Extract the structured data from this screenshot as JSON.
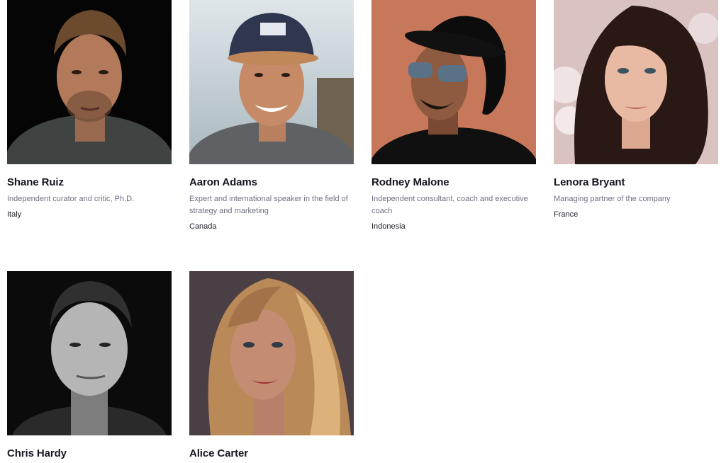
{
  "team": {
    "members": [
      {
        "name": "Shane Ruiz",
        "role": "Independent curator and critic, Ph.D.",
        "country": "Italy"
      },
      {
        "name": "Aaron Adams",
        "role": "Expert and international speaker in the field of strategy and marketing",
        "country": "Canada"
      },
      {
        "name": "Rodney Malone",
        "role": "Independent consultant, coach and executive coach",
        "country": "Indonesia"
      },
      {
        "name": "Lenora Bryant",
        "role": "Managing partner of the company",
        "country": "France"
      },
      {
        "name": "Chris Hardy",
        "role": "",
        "country": ""
      },
      {
        "name": "Alice Carter",
        "role": "",
        "country": ""
      }
    ]
  },
  "colors": {
    "name_text": "#15161f",
    "role_text": "#6f7180",
    "country_text": "#1f2028"
  }
}
